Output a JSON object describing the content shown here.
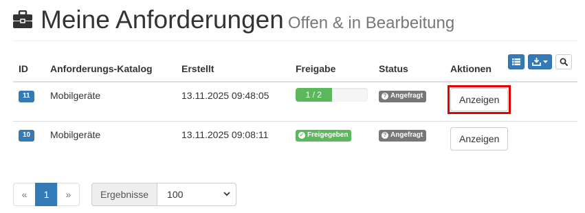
{
  "header": {
    "icon": "briefcase-icon",
    "title": "Meine Anforderungen",
    "subtitle": "Offen & in Bearbeitung"
  },
  "table": {
    "columns": {
      "id": "ID",
      "catalog": "Anforderungs-Katalog",
      "created": "Erstellt",
      "release": "Freigabe",
      "status": "Status",
      "actions": "Aktionen"
    },
    "toolbar": {
      "list_icon": "list-icon",
      "export_icon": "export-icon",
      "search_icon": "search-icon"
    },
    "rows": [
      {
        "id": "11",
        "catalog": "Mobilgeräte",
        "created": "13.11.2025 09:48:05",
        "release_progress_text": "1 / 2",
        "release_progress_fraction": 0.5,
        "status": "Angefragt",
        "action": "Anzeigen"
      },
      {
        "id": "10",
        "catalog": "Mobilgeräte",
        "created": "13.11.2025 09:08:11",
        "release_label": "Freigegeben",
        "status": "Angefragt",
        "action": "Anzeigen"
      }
    ]
  },
  "pagination": {
    "prev": "«",
    "current": "1",
    "next": "»"
  },
  "results": {
    "label": "Ergebnisse",
    "selected": "100"
  },
  "colors": {
    "primary": "#337ab7",
    "success": "#5cb85c",
    "default_label": "#777777",
    "highlight": "#e00000"
  }
}
